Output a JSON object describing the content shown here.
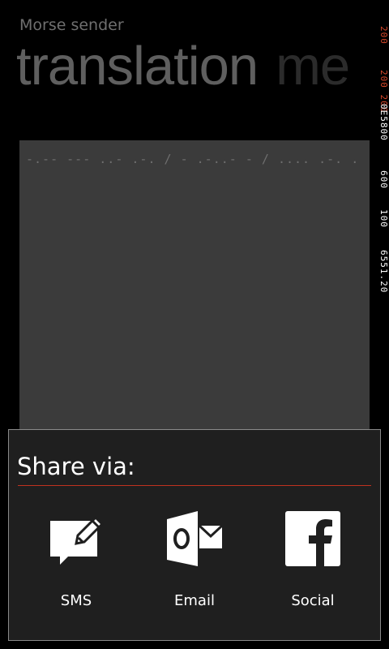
{
  "app": {
    "title": "Morse sender"
  },
  "pivot": {
    "active_tab": "translation",
    "next_tab": "me"
  },
  "debug_counters": {
    "c1": "200",
    "c2": "200 200",
    "c3": "0E5800",
    "c4": "600",
    "c5": "100",
    "c6": "6551.20"
  },
  "message": {
    "morse": "-.-- --- ..- .-. / - .-..- - / .... .-. ."
  },
  "share": {
    "title": "Share via:",
    "options": [
      {
        "label": "SMS",
        "icon": "sms-icon"
      },
      {
        "label": "Email",
        "icon": "outlook-email-icon"
      },
      {
        "label": "Social",
        "icon": "facebook-icon"
      }
    ]
  },
  "colors": {
    "accent": "#c0311f",
    "debug_red": "#d9482a",
    "panel_bg": "#1f1f1f",
    "textbox_bg": "#3b3b3b"
  }
}
